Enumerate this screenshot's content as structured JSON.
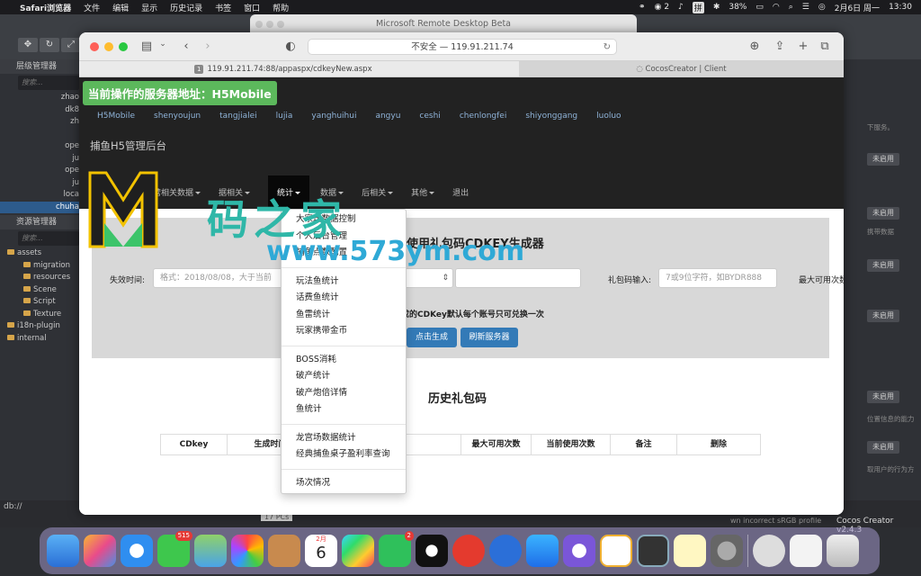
{
  "menubar": {
    "app": "Safari浏览器",
    "items": [
      "文件",
      "编辑",
      "显示",
      "历史记录",
      "书签",
      "窗口",
      "帮助"
    ],
    "battery": "38%",
    "wechat_count": "2",
    "input_method": "拼",
    "date": "2月6日 周一",
    "time": "13:30"
  },
  "remote_desktop": {
    "title": "Microsoft Remote Desktop Beta"
  },
  "cocos": {
    "hierarchy_title": "层级管理器",
    "hierarchy_search": "搜索...",
    "hierarchy_items": [
      "zhao",
      "dk8",
      "zh",
      "ope",
      "ju",
      "ope",
      "ju",
      "loca",
      "chuha"
    ],
    "assets_title": "资源管理器",
    "assets_search": "搜索...",
    "assets_items": [
      "assets",
      "migration",
      "resources",
      "Scene",
      "Script",
      "Texture",
      "i18n-plugin",
      "internal"
    ],
    "right_badges": [
      "未启用",
      "未启用",
      "未启用",
      "未启用",
      "未启用",
      "未启用"
    ],
    "right_texts": [
      "下服务。",
      "携带数据",
      "位置信息的能力",
      "取用户的行为方"
    ],
    "status_left": "db://",
    "status_warning": "wn incorrect sRGB profile",
    "status_version": "Cocos Creator v2.4.3",
    "pcs": "17 PCs"
  },
  "safari": {
    "address": "不安全 — 119.91.211.74",
    "tabs": [
      {
        "num": "1",
        "label": "119.91.211.74:88/appaspx/cdkeyNew.aspx"
      },
      {
        "label": "CocosCreator | Client"
      }
    ]
  },
  "page": {
    "server_tag": "当前操作的服务器地址：H5Mobile",
    "servers": [
      "H5Mobile",
      "shenyoujun",
      "tangjialei",
      "lujia",
      "yanghuihui",
      "angyu",
      "ceshi",
      "chenlongfei",
      "shiyonggang",
      "luoluo"
    ],
    "brand": "捕鱼H5管理后台",
    "menu": [
      "运营相关数据",
      "活动相关",
      "统计相关",
      "数据",
      "后台设置",
      "其他",
      "退出"
    ],
    "menu_visible": [
      "营相关数据",
      "据相关",
      "统计",
      "数据",
      "后相关",
      "其他",
      "退出"
    ],
    "panel_title": "使用礼包码CDKEY生成器",
    "expire_label": "失效时间:",
    "expire_placeholder": "格式：2018/08/08，大于当前",
    "code_label": "礼包码输入:",
    "code_placeholder": "7或9位字符，如BYDR888",
    "max_label": "最大可用次数",
    "note": "成的CDKey默认每个账号只可兑换一次",
    "generate_btn": "点击生成",
    "refresh_btn": "刷新服务器",
    "history_title": "历史礼包码",
    "table_headers": [
      "CDkey",
      "生成时间",
      "礼包内容",
      "最大可用次数",
      "当前使用次数",
      "备注",
      "删除"
    ]
  },
  "dropdown": {
    "groups": [
      [
        "大家玩数据控制",
        "个人后台管理",
        "捕鱼点数配置"
      ],
      [
        "玩法鱼统计",
        "话费鱼统计",
        "鱼雷统计",
        "玩家携带金币"
      ],
      [
        "BOSS消耗",
        "破产统计",
        "破产炮倍详情",
        "鱼统计"
      ],
      [
        "龙宫场数据统计",
        "经典捕鱼桌子盈利率查询"
      ],
      [
        "场次情况"
      ]
    ]
  },
  "watermark": {
    "text": "码之家",
    "url": "www.573ym.com"
  },
  "dock": {
    "messages_badge": "515",
    "calendar_month": "2月",
    "calendar_day": "6",
    "wechat_badge": "2"
  },
  "colors": {
    "nav_bg": "#222222",
    "server_tag": "#5cb85c",
    "btn_primary": "#337ab7",
    "panel_bg": "#d8d8d8"
  }
}
